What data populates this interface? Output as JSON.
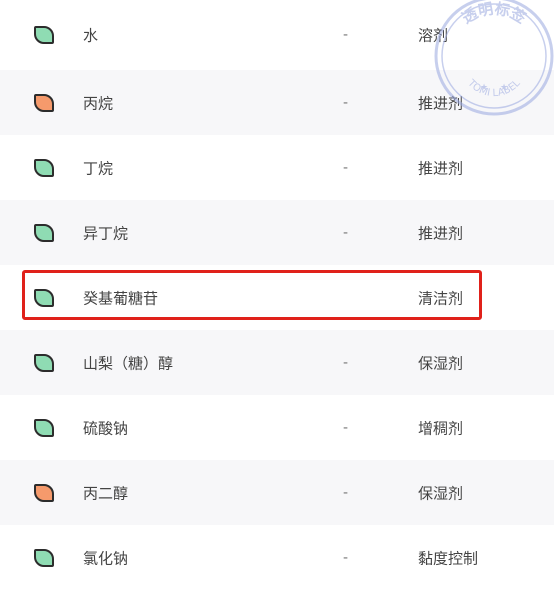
{
  "ingredients": [
    {
      "name": "水",
      "dash": "-",
      "function": "溶剂",
      "leaf_color": "green"
    },
    {
      "name": "丙烷",
      "dash": "-",
      "function": "推进剂",
      "leaf_color": "orange"
    },
    {
      "name": "丁烷",
      "dash": "-",
      "function": "推进剂",
      "leaf_color": "green"
    },
    {
      "name": "异丁烷",
      "dash": "-",
      "function": "推进剂",
      "leaf_color": "green"
    },
    {
      "name": "癸基葡糖苷",
      "dash": "",
      "function": "清洁剂",
      "leaf_color": "green"
    },
    {
      "name": "山梨（糖）醇",
      "dash": "-",
      "function": "保湿剂",
      "leaf_color": "green"
    },
    {
      "name": "硫酸钠",
      "dash": "-",
      "function": "增稠剂",
      "leaf_color": "green"
    },
    {
      "name": "丙二醇",
      "dash": "-",
      "function": "保湿剂",
      "leaf_color": "orange"
    },
    {
      "name": "氯化钠",
      "dash": "-",
      "function": "黏度控制",
      "leaf_color": "green"
    }
  ],
  "stamp": {
    "text_top": "透明标签",
    "text_bottom": "TOMI LABEL"
  },
  "colors": {
    "green_leaf": "#8fdcb3",
    "orange_leaf": "#f59a6c",
    "highlight": "#e0211a",
    "stamp": "#9aa8e0"
  }
}
